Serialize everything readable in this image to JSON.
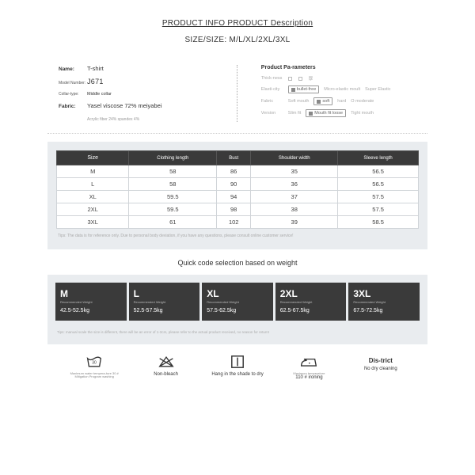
{
  "heading": "PRODUCT INFO PRODUCT Description",
  "sizes_line": "SIZE/SIZE: M/L/XL/2XL/3XL",
  "left": {
    "name_label": "Name:",
    "name_value": "T-shirt",
    "model_label": "Model Number:",
    "model_value": "J671",
    "collar_label": "Collar-type:",
    "collar_value": "Middle collar",
    "fabric_label": "Fabric:",
    "fabric_value": "Yasel viscose 72% meiyabei",
    "fiber_note": "Acrylic fiber 24% spandex 4%"
  },
  "params": {
    "title": "Product Pa-rameters",
    "rows": [
      {
        "label": "Thick-ness",
        "opts": [
          "",
          "",
          "厚"
        ],
        "sel": -1
      },
      {
        "label": "Elasti-city",
        "opts": [
          "bullet-free",
          "Micro-elastic moult",
          "Super Elastic"
        ],
        "sel": 0
      },
      {
        "label": "Fabric",
        "opts": [
          "Soft mouth",
          "soft",
          "hard",
          "O moderate"
        ],
        "sel": 1
      },
      {
        "label": "Version",
        "opts": [
          "Slim fit",
          "Mouth fit loose",
          "Tight mouth"
        ],
        "sel": 1
      }
    ]
  },
  "size_table": {
    "headers": [
      "Size",
      "Clothing length",
      "Bust",
      "Shoulder width",
      "Sleeve length"
    ],
    "rows": [
      [
        "M",
        "58",
        "86",
        "35",
        "56.5"
      ],
      [
        "L",
        "58",
        "90",
        "36",
        "56.5"
      ],
      [
        "XL",
        "59.5",
        "94",
        "37",
        "57.5"
      ],
      [
        "2XL",
        "59.5",
        "98",
        "38",
        "57.5"
      ],
      [
        "3XL",
        "61",
        "102",
        "39",
        "58.5"
      ]
    ],
    "tips": "Tips: The data is for reference only. Due to personal body deviation, if you have any questions, please consult online customer service!"
  },
  "quick_heading": "Quick code selection based on weight",
  "weights": [
    {
      "size": "M",
      "label": "Recommended Weight",
      "range": "42.5-52.5kg"
    },
    {
      "size": "L",
      "label": "Recommended Weight",
      "range": "52.5-57.5kg"
    },
    {
      "size": "XL",
      "label": "Recommended Weight",
      "range": "57.5-62.5kg"
    },
    {
      "size": "2XL",
      "label": "Recommended Weight",
      "range": "62.5-67.5kg"
    },
    {
      "size": "3XL",
      "label": "Recommended Weight",
      "range": "67.5-72.5kg"
    }
  ],
  "weight_tips": "Tips: manual scale the size is different, there will be an error of 1-3cm, please refer to the actual product received, no reason for return!",
  "care": [
    {
      "line1": "",
      "line2": "Maximum water tempera-ture 30 #",
      "line3": "Mitigation Program washing"
    },
    {
      "line1": "Non-bleach",
      "line2": ""
    },
    {
      "line1": "Hang in the shade to dry",
      "line2": ""
    },
    {
      "line1": "",
      "line2": "Maximum temperature",
      "line3": "110 # ironing"
    },
    {
      "line1": "Dis-trict",
      "line2": "No dry cleaning"
    }
  ]
}
